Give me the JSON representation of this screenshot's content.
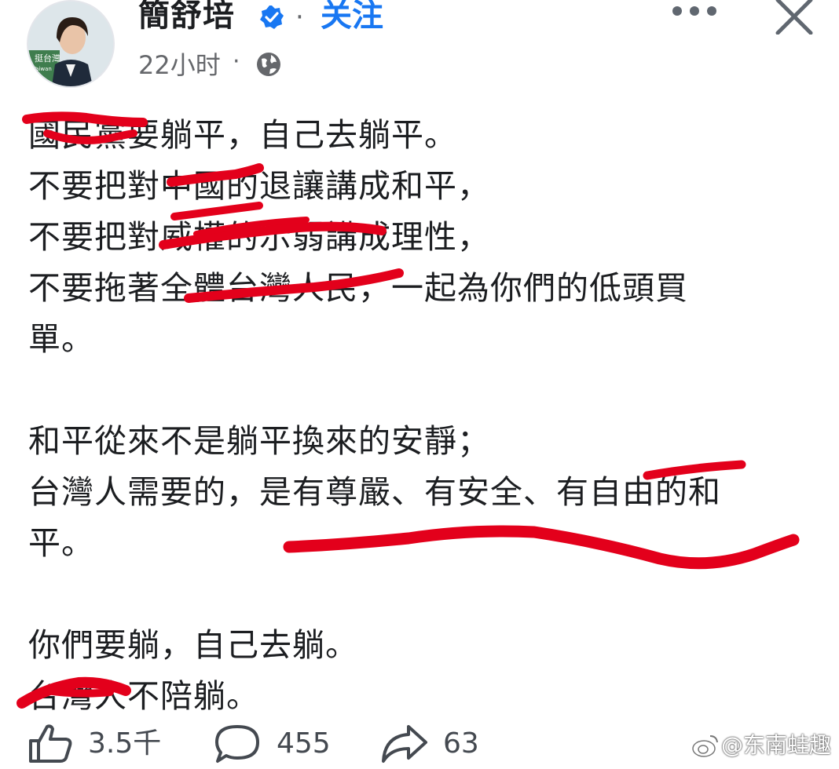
{
  "post": {
    "author": "簡舒培",
    "follow_label": "关注",
    "separator": "·",
    "timestamp": "22小时",
    "audience_icon": "globe-icon",
    "avatar_caption": "挺台灣",
    "avatar_badge": "Taiwan",
    "lines": [
      "國民黨要躺平，自己去躺平。",
      "不要把對中國的退讓講成和平，",
      "不要把對威權的示弱講成理性，",
      "不要拖著全體台灣人民，一起為你們的低頭買",
      "單。",
      "",
      "和平從來不是躺平換來的安靜；",
      "台灣人需要的，是有尊嚴、有安全、有自由的和",
      "平。",
      "",
      "你們要躺，自己去躺。",
      "台灣人不陪躺。"
    ]
  },
  "actions": {
    "likes": "3.5千",
    "comments": "455",
    "shares": "63"
  },
  "watermark": "@东南蛙趣",
  "colors": {
    "accent": "#1877f2",
    "scribble": "#e3001b",
    "text": "#1c1e21",
    "muted": "#65676b"
  }
}
